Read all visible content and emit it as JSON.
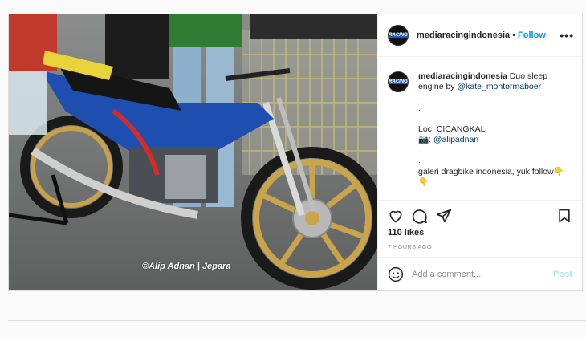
{
  "post": {
    "username": "mediaracingindonesia",
    "avatar_text": "RACING",
    "follow_label": "Follow",
    "separator": "•",
    "more_label": "•••",
    "image_alt": "Drag bike motorcycle with gold wheels",
    "watermark": "©Alip Adnan | Jepara",
    "caption": {
      "username": "mediaracingindonesia",
      "text_before_mention": "Duo sleep engine by ",
      "mention1": "@kate_montormaboer",
      "dot1": ".",
      "dot2": ".",
      "loc": "Loc: CICANGKAL",
      "camera_prefix": "📷: ",
      "mention2": "@alipadnan",
      "dot3": ".",
      "dot4": ".",
      "closing": "galeri dragbike indonesia, yuk follow👇",
      "closing2": "👇"
    },
    "likes": "110 likes",
    "time": "7 HOURS AGO",
    "comment_placeholder": "Add a comment...",
    "post_label": "Post"
  },
  "icons": {
    "like": "heart-icon",
    "comment": "comment-icon",
    "share": "share-icon",
    "save": "bookmark-icon",
    "emoji": "emoji-icon"
  }
}
